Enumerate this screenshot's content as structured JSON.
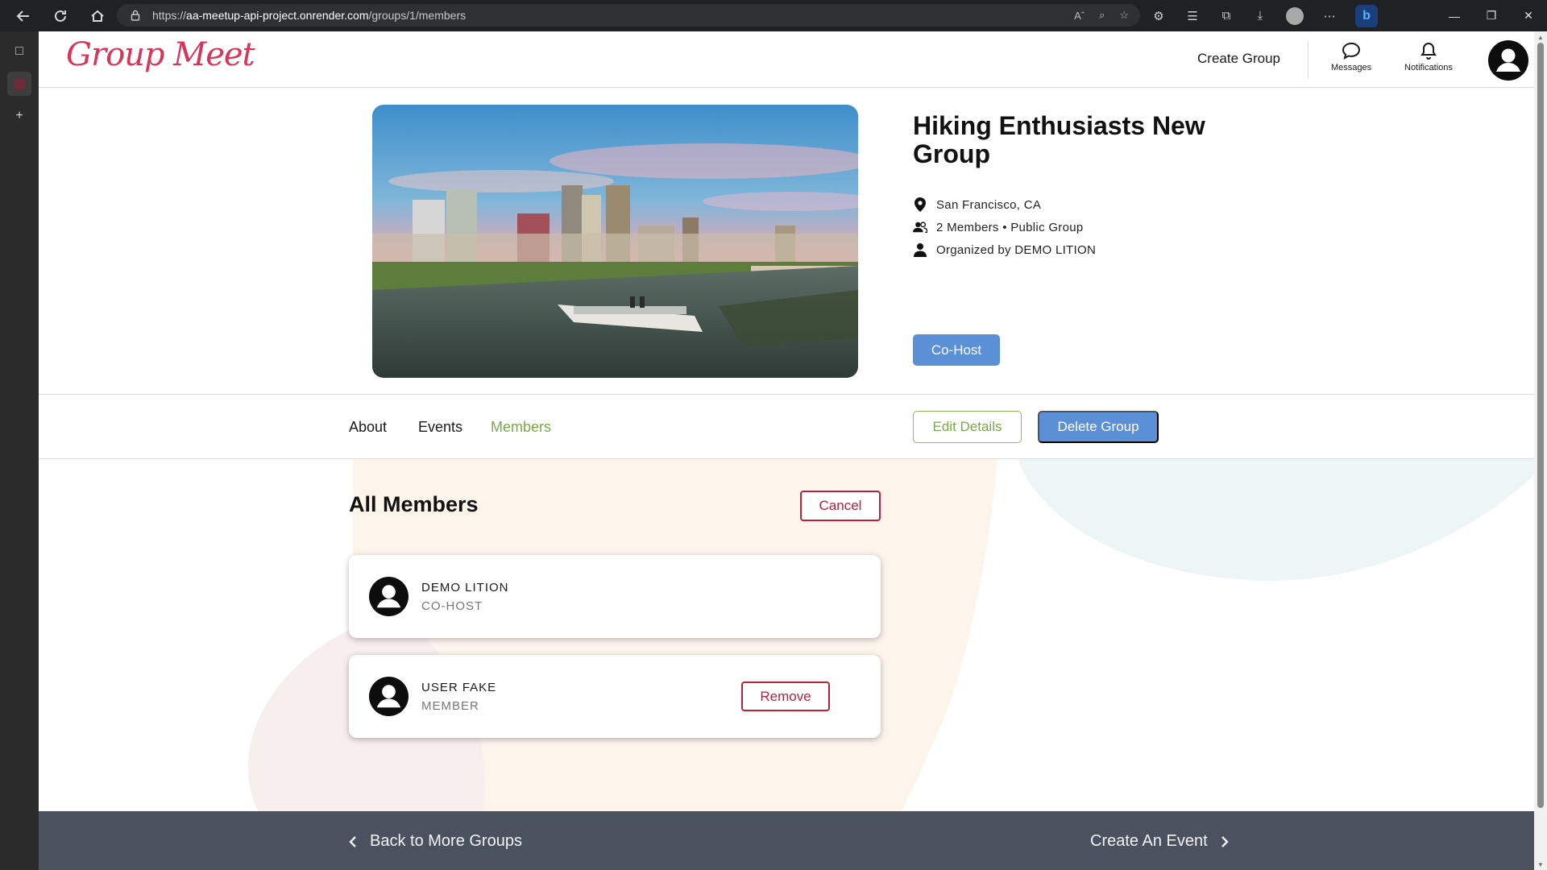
{
  "browser": {
    "url_prefix": "https://",
    "url_host": "aa-meetup-api-project.onrender.com",
    "url_path": "/groups/1/members",
    "icons": [
      "back-icon",
      "refresh-icon",
      "home-icon",
      "lock-icon",
      "read-aloud-icon",
      "zoom-icon",
      "favorite-add-icon",
      "extensions-icon",
      "favorites-icon",
      "collections-icon",
      "downloads-icon",
      "profile-icon",
      "more-icon",
      "bing-icon"
    ],
    "window_controls": [
      "minimize-icon",
      "restore-icon",
      "close-icon"
    ]
  },
  "header": {
    "logo": "Group Meet",
    "create_group": "Create Group",
    "messages": "Messages",
    "notifications": "Notifications"
  },
  "group": {
    "title": "Hiking Enthusiasts New Group",
    "location": "San Francisco, CA",
    "members_info": "2 Members • Public Group",
    "organizer": "Organized by DEMO LITION",
    "role_button": "Co-Host"
  },
  "tabs": [
    {
      "label": "About",
      "active": false
    },
    {
      "label": "Events",
      "active": false
    },
    {
      "label": "Members",
      "active": true
    }
  ],
  "actions": {
    "edit": "Edit Details",
    "delete": "Delete Group"
  },
  "members_section": {
    "title": "All Members",
    "cancel": "Cancel",
    "members": [
      {
        "name": "DEMO LITION",
        "role": "CO-HOST"
      },
      {
        "name": "USER FAKE",
        "role": "MEMBER",
        "action": "Remove"
      }
    ]
  },
  "footer": {
    "back": "Back to More Groups",
    "create_event": "Create An Event"
  },
  "colors": {
    "brand": "#d7355a",
    "primary_button": "#5b8fd6",
    "active_tab": "#7aa84a",
    "danger": "#b3233c",
    "footer_bg": "#4a5260"
  }
}
